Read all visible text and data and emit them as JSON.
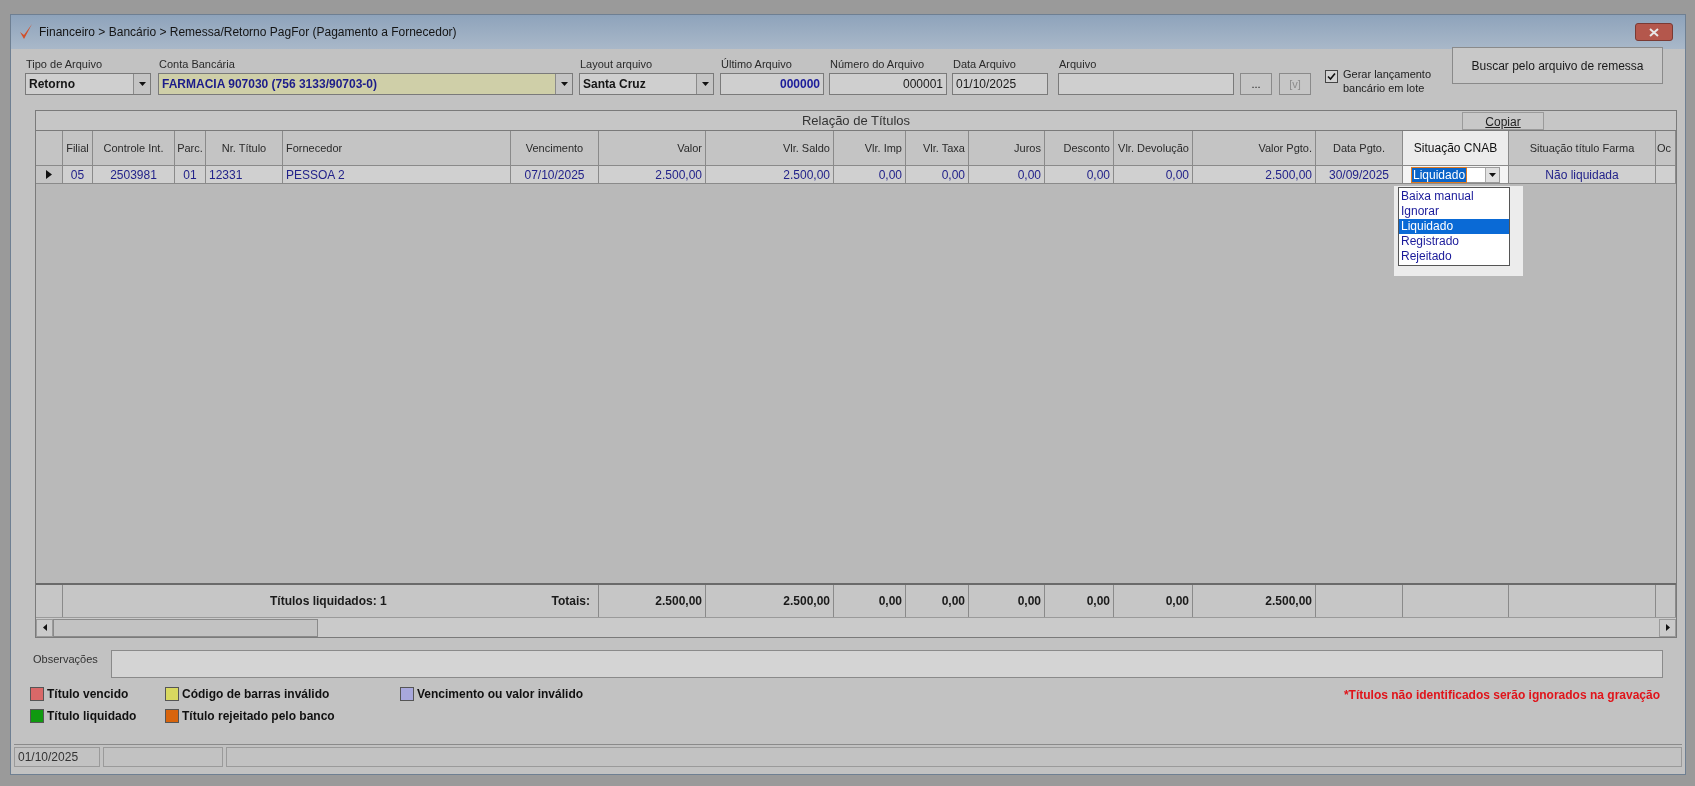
{
  "window": {
    "title": "Financeiro > Bancário > Remessa/Retorno PagFor (Pagamento  a Fornecedor)"
  },
  "filters": [
    {
      "kind": "select",
      "label": "Tipo de Arquivo",
      "value": "Retorno"
    },
    {
      "kind": "select",
      "label": "Conta Bancária",
      "value": "FARMACIA 907030 (756 3133/90703-0)"
    },
    {
      "kind": "select",
      "label": "Layout arquivo",
      "value": "Santa Cruz"
    },
    {
      "kind": "field",
      "label": "Último Arquivo",
      "value": "000000"
    },
    {
      "kind": "field",
      "label": "Número do Arquivo",
      "value": "000001"
    },
    {
      "kind": "field",
      "label": "Data Arquivo",
      "value": "01/10/2025"
    },
    {
      "kind": "field",
      "label": "Arquivo"
    }
  ],
  "browse_button": {
    "label": "...",
    "disabled": false
  },
  "view_button": {
    "label": "[v]",
    "disabled": true
  },
  "batch_checkbox": {
    "label": "Gerar lançamento bancário em lote",
    "checked": true
  },
  "search_button": "Buscar pelo arquivo de remessa",
  "table": {
    "title": "Relação de Títulos",
    "copy_button": "Copiar",
    "columns": [
      "Filial",
      "Controle Int.",
      "Parc.",
      "Nr. Título",
      "Fornecedor",
      "Vencimento",
      "Valor",
      "Vlr. Saldo",
      "Vlr. Imp",
      "Vlr. Taxa",
      "Juros",
      "Desconto",
      "Vlr. Devolução",
      "Valor Pgto.",
      "Data Pgto.",
      "Situação CNAB",
      "Situação título Farma",
      "Oc"
    ],
    "rows": [
      {
        "selected": true,
        "cells": [
          "05",
          "2503981",
          "01",
          "12331",
          "PESSOA 2",
          "07/10/2025",
          "2.500,00",
          "2.500,00",
          "0,00",
          "0,00",
          "0,00",
          "0,00",
          "0,00",
          "2.500,00",
          "30/09/2025",
          "Liquidado",
          "Não liquidada",
          ""
        ]
      }
    ],
    "cnab_dropdown": {
      "options": [
        {
          "label": "Baixa manual",
          "selected": false
        },
        {
          "label": "Ignorar",
          "selected": false
        },
        {
          "label": "Liquidado",
          "selected": true
        },
        {
          "label": "Registrado",
          "selected": false
        },
        {
          "label": "Rejeitado",
          "selected": false
        }
      ]
    },
    "footer": {
      "count_label": "Títulos liquidados: 1",
      "totals_label": "Totais:",
      "totals": [
        "2.500,00",
        "2.500,00",
        "0,00",
        "0,00",
        "0,00",
        "0,00",
        "0,00",
        "2.500,00"
      ]
    }
  },
  "notes_label": "Observações",
  "legend": [
    {
      "label": "Título vencido",
      "color": "#d96868"
    },
    {
      "label": "Código de barras inválido",
      "color": "#d8d860"
    },
    {
      "label": "Vencimento ou valor inválido",
      "color": "#a8a8dc"
    },
    {
      "label": "Título liquidado",
      "color": "#109a10"
    },
    {
      "label": "Título rejeitado pelo banco",
      "color": "#d8640c"
    }
  ],
  "warning": "*Títulos não identificados serão ignorados na gravação",
  "status_bar": [
    "01/10/2025"
  ]
}
